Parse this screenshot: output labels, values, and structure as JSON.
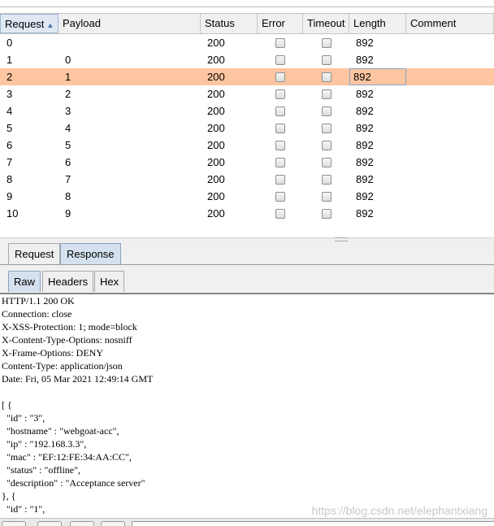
{
  "table": {
    "columns": [
      "Request",
      "Payload",
      "Status",
      "Error",
      "Timeout",
      "Length",
      "Comment"
    ],
    "sorted_column": "Request",
    "rows": [
      {
        "request": "0",
        "payload": "",
        "status": "200",
        "length": "892"
      },
      {
        "request": "1",
        "payload": "0",
        "status": "200",
        "length": "892"
      },
      {
        "request": "2",
        "payload": "1",
        "status": "200",
        "length": "892"
      },
      {
        "request": "3",
        "payload": "2",
        "status": "200",
        "length": "892"
      },
      {
        "request": "4",
        "payload": "3",
        "status": "200",
        "length": "892"
      },
      {
        "request": "5",
        "payload": "4",
        "status": "200",
        "length": "892"
      },
      {
        "request": "6",
        "payload": "5",
        "status": "200",
        "length": "892"
      },
      {
        "request": "7",
        "payload": "6",
        "status": "200",
        "length": "892"
      },
      {
        "request": "8",
        "payload": "7",
        "status": "200",
        "length": "892"
      },
      {
        "request": "9",
        "payload": "8",
        "status": "200",
        "length": "892"
      },
      {
        "request": "10",
        "payload": "9",
        "status": "200",
        "length": "892"
      }
    ],
    "selected_row_index": 2,
    "selected_row_color": "#fdc5a0"
  },
  "message_tabs": [
    "Request",
    "Response"
  ],
  "active_message_tab": "Response",
  "view_tabs": [
    "Raw",
    "Headers",
    "Hex"
  ],
  "active_view_tab": "Raw",
  "response_lines": [
    "HTTP/1.1 200 OK",
    "Connection: close",
    "X-XSS-Protection: 1; mode=block",
    "X-Content-Type-Options: nosniff",
    "X-Frame-Options: DENY",
    "Content-Type: application/json",
    "Date: Fri, 05 Mar 2021 12:49:14 GMT",
    "",
    "[ {",
    "  \"id\" : \"3\",",
    "  \"hostname\" : \"webgoat-acc\",",
    "  \"ip\" : \"192.168.3.3\",",
    "  \"mac\" : \"EF:12:FE:34:AA:CC\",",
    "  \"status\" : \"offline\",",
    "  \"description\" : \"Acceptance server\"",
    "}, {",
    "  \"id\" : \"1\","
  ],
  "watermark": "https://blog.csdn.net/elephantxiang"
}
